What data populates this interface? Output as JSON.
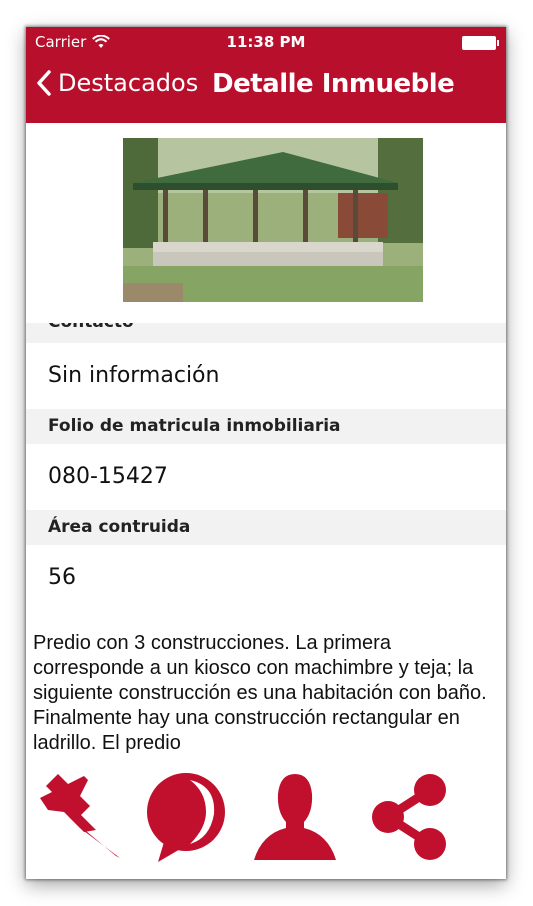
{
  "status_bar": {
    "carrier": "Carrier",
    "time": "11:38 PM",
    "wifi_icon": "wifi-icon",
    "battery_icon": "battery-icon"
  },
  "nav": {
    "back_label": "Destacados",
    "title": "Detalle Inmueble",
    "back_icon": "chevron-left-icon"
  },
  "photo": {
    "icon": "property-photo"
  },
  "sections": [
    {
      "header": "Contacto",
      "value": "Sin información"
    },
    {
      "header": "Folio de matricula inmobiliaria",
      "value": "080-15427"
    },
    {
      "header": "Área contruida",
      "value": "56"
    }
  ],
  "description": "Predio con 3 construcciones. La primera corresponde a un kiosco con machimbre y teja; la siguiente construcción es una habitación con baño. Finalmente hay una construcción rectangular en ladrillo. El predio",
  "actions": [
    {
      "icon": "pin-icon"
    },
    {
      "icon": "chat-bubble-icon"
    },
    {
      "icon": "person-icon"
    },
    {
      "icon": "share-icon"
    }
  ],
  "colors": {
    "brand": "#b8102c",
    "section_bg": "#f2f2f2"
  }
}
